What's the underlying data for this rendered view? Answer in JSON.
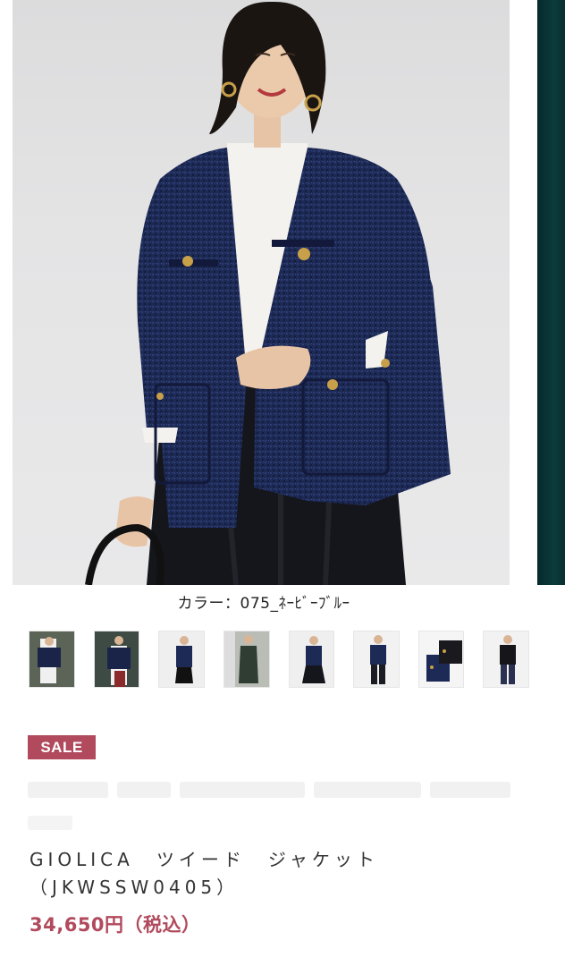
{
  "gallery": {
    "main_image": "model-wearing-navy-tweed-jacket",
    "color_caption": "カラー：075_ﾈｰﾋﾞｰﾌﾞﾙｰ",
    "thumbnails": [
      {
        "name": "thumb-1",
        "subject": "model-navy-jacket-striped-top-dark"
      },
      {
        "name": "thumb-2",
        "subject": "model-navy-jacket-striped-top"
      },
      {
        "name": "thumb-3",
        "subject": "model-navy-jacket-full-length"
      },
      {
        "name": "thumb-4",
        "subject": "model-green-coat-full-length"
      },
      {
        "name": "thumb-5",
        "subject": "model-navy-jacket-skirt"
      },
      {
        "name": "thumb-6",
        "subject": "model-navy-jacket-pants"
      },
      {
        "name": "thumb-7",
        "subject": "two-jackets-flatlay"
      },
      {
        "name": "thumb-8",
        "subject": "model-black-jacket-pants"
      }
    ]
  },
  "product": {
    "badge": "SALE",
    "name": "GIOLICA　ツイード　ジャケット（JKWSSW0405）",
    "price": "34,650円（税込）"
  },
  "colors": {
    "accent": "#b14a5d",
    "jacket": "#1c2a52",
    "text": "#333333"
  }
}
